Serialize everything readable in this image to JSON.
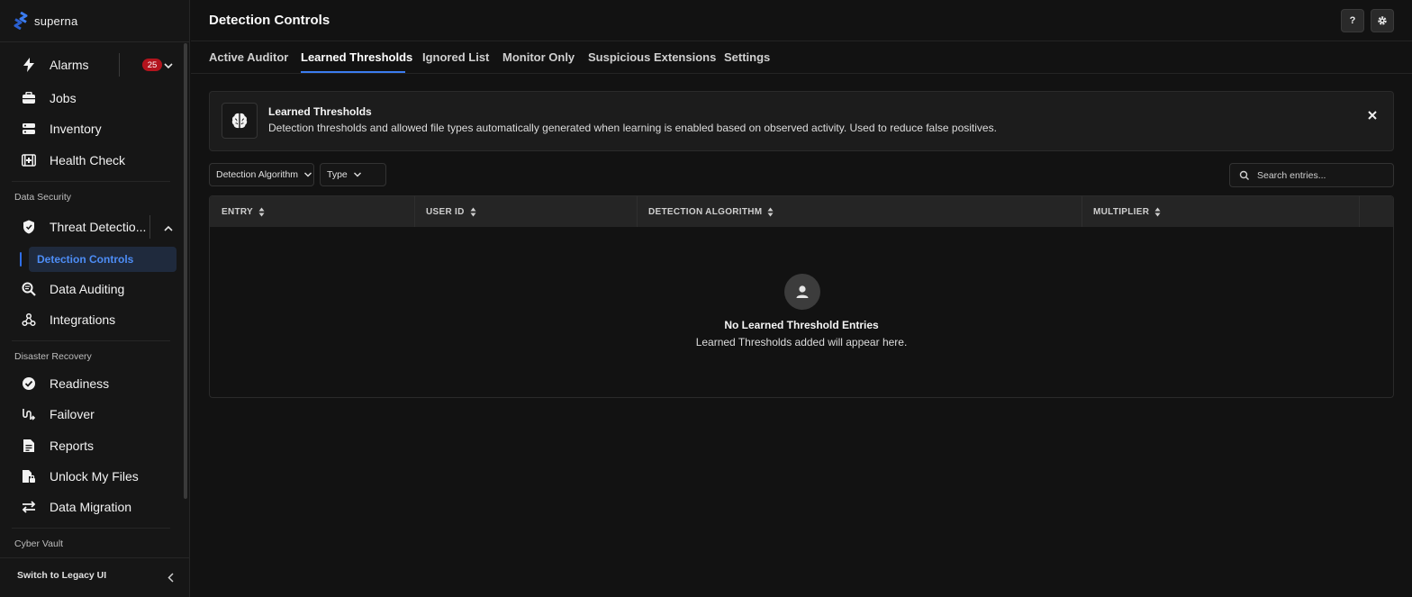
{
  "brand": {
    "name": "superna",
    "accent": "#3b7cf0"
  },
  "sidebar": {
    "items": [
      {
        "label": "Alarms",
        "icon": "bolt-icon",
        "badge": "25"
      },
      {
        "label": "Jobs",
        "icon": "briefcase-icon"
      },
      {
        "label": "Inventory",
        "icon": "server-icon"
      },
      {
        "label": "Health Check",
        "icon": "medical-icon"
      }
    ],
    "sections": {
      "data_security": "Data Security",
      "disaster_recovery": "Disaster Recovery",
      "cyber_vault": "Cyber Vault"
    },
    "data_security_items": [
      {
        "label": "Threat Detectio...",
        "icon": "shield-icon"
      },
      {
        "label": "Data Auditing",
        "icon": "search-doc-icon"
      },
      {
        "label": "Integrations",
        "icon": "integrations-icon"
      }
    ],
    "sub_item": "Detection Controls",
    "disaster_recovery_items": [
      {
        "label": "Readiness",
        "icon": "check-circle-icon"
      },
      {
        "label": "Failover",
        "icon": "failover-icon"
      },
      {
        "label": "Reports",
        "icon": "report-icon"
      },
      {
        "label": "Unlock My Files",
        "icon": "file-lock-icon"
      },
      {
        "label": "Data Migration",
        "icon": "swap-icon"
      }
    ],
    "legacy_label": "Switch to Legacy UI"
  },
  "header": {
    "title": "Detection Controls",
    "help_label": "?"
  },
  "tabs": [
    "Active Auditor",
    "Learned Thresholds",
    "Ignored List",
    "Monitor Only",
    "Suspicious Extensions",
    "Settings"
  ],
  "active_tab": "Learned Thresholds",
  "banner": {
    "title": "Learned Thresholds",
    "description": "Detection thresholds and allowed file types automatically generated when learning is enabled based on observed activity. Used to reduce false positives."
  },
  "filters": {
    "algorithm": "Detection Algorithm",
    "type": "Type"
  },
  "search": {
    "placeholder": "Search entries..."
  },
  "table": {
    "columns": [
      "ENTRY",
      "USER ID",
      "DETECTION ALGORITHM",
      "MULTIPLIER"
    ],
    "empty_title": "No Learned Threshold Entries",
    "empty_desc": "Learned Thresholds added will appear here."
  }
}
